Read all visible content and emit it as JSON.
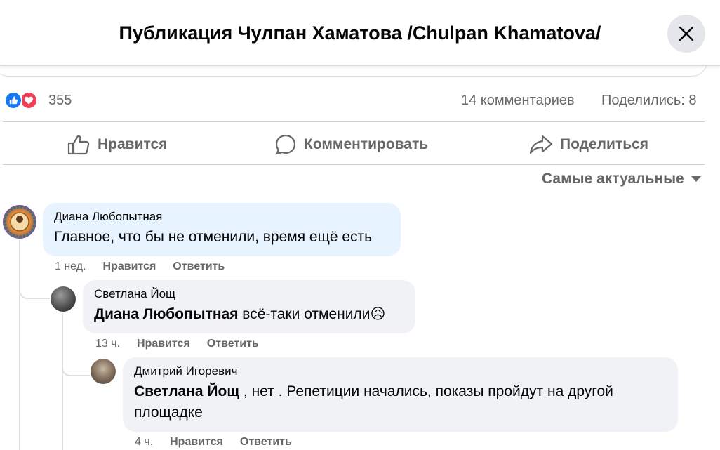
{
  "header": {
    "title": "Публикация Чулпан Хаматова /Chulpan Khamatova/"
  },
  "stats": {
    "reactions_count": "355",
    "comments": "14 комментариев",
    "shares": "Поделились: 8"
  },
  "actions": {
    "like": "Нравится",
    "comment": "Комментировать",
    "share": "Поделиться"
  },
  "sort": {
    "label": "Самые актуальные"
  },
  "comments": [
    {
      "author": "Диана Любопытная",
      "text": "Главное, что бы не отменили, время ещё есть",
      "time": "1 нед.",
      "like": "Нравится",
      "reply": "Ответить"
    },
    {
      "author": "Светлана Йощ",
      "mention": "Диана Любопытная",
      "text": " всё-таки отменили",
      "emoji": "😥",
      "time": "13 ч.",
      "like": "Нравится",
      "reply": "Ответить"
    },
    {
      "author": "Дмитрий Игоревич",
      "mention": "Светлана Йощ",
      "text_line1": " , нет . Репетиции начались, показы пройдут на другой",
      "text_line2": "площадке",
      "time": "4 ч.",
      "like": "Нравится",
      "reply": "Ответить"
    }
  ],
  "colors": {
    "brand_blue": "#1877f2",
    "love_red": "#f33e58",
    "bubble_gray": "#f0f2f5",
    "bubble_highlight": "#e7f3ff",
    "secondary_text": "#65676b"
  },
  "icons": [
    "close-icon",
    "like-reaction-icon",
    "love-reaction-icon",
    "thumbs-up-icon",
    "comment-icon",
    "share-icon",
    "caret-down-icon"
  ]
}
